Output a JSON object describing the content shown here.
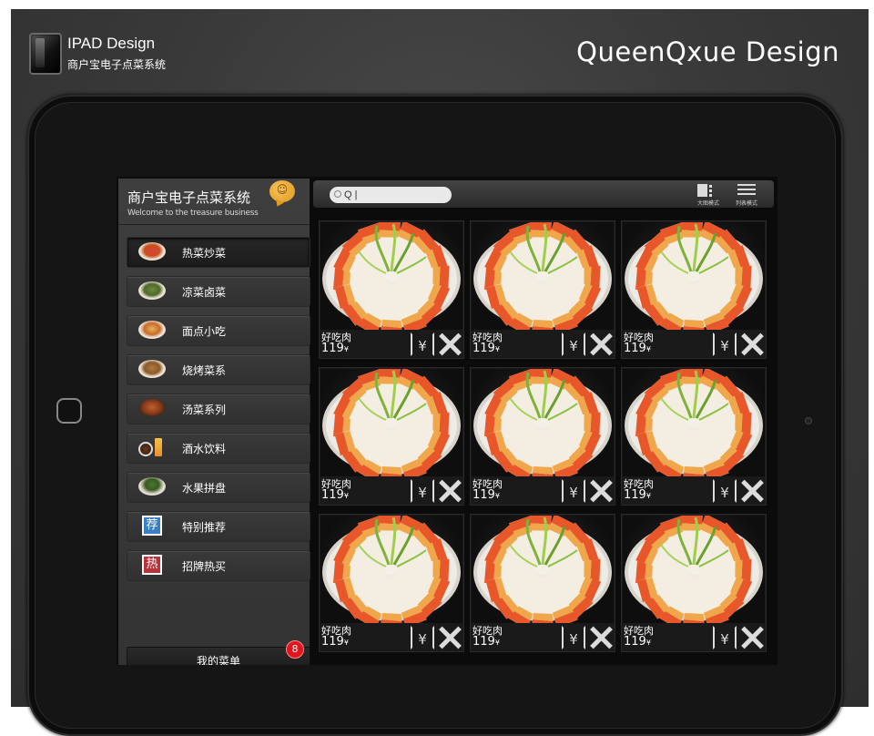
{
  "header": {
    "brand_title": "IPAD Design",
    "brand_subtitle": "商户宝电子点菜系统",
    "top_right": "QueenQxue Design"
  },
  "app": {
    "title": "商户宝电子点菜系统",
    "subtitle": "Welcome to the treasure business",
    "bubble": "☺"
  },
  "sidebar": {
    "items": [
      {
        "label": "热菜炒菜",
        "icon": "dish-icon",
        "active": true
      },
      {
        "label": "凉菜卤菜",
        "icon": "dish-icon"
      },
      {
        "label": "面点小吃",
        "icon": "dish-icon"
      },
      {
        "label": "烧烤菜系",
        "icon": "dish-icon"
      },
      {
        "label": "汤菜系列",
        "icon": "soup-icon"
      },
      {
        "label": "酒水饮料",
        "icon": "drink-icon"
      },
      {
        "label": "水果拼盘",
        "icon": "fruit-icon"
      },
      {
        "label": "特别推荐",
        "icon": "recommend-icon",
        "tag": "荐"
      },
      {
        "label": "招牌热买",
        "icon": "hot-icon",
        "tag": "热"
      }
    ],
    "cart": {
      "label": "我的菜单",
      "count": "8"
    }
  },
  "search": {
    "value": "Q |",
    "placeholder": ""
  },
  "view_modes": {
    "large": "大图模式",
    "list": "列表模式"
  },
  "dishes": [
    {
      "name": "好吃肉",
      "price": "119",
      "currency": "¥"
    },
    {
      "name": "好吃肉",
      "price": "119",
      "currency": "¥"
    },
    {
      "name": "好吃肉",
      "price": "119",
      "currency": "¥"
    },
    {
      "name": "好吃肉",
      "price": "119",
      "currency": "¥"
    },
    {
      "name": "好吃肉",
      "price": "119",
      "currency": "¥"
    },
    {
      "name": "好吃肉",
      "price": "119",
      "currency": "¥"
    },
    {
      "name": "好吃肉",
      "price": "119",
      "currency": "¥"
    },
    {
      "name": "好吃肉",
      "price": "119",
      "currency": "¥"
    },
    {
      "name": "好吃肉",
      "price": "119",
      "currency": "¥"
    }
  ],
  "order_button_symbol": "¥",
  "colors": {
    "background": "#3a3a3a",
    "device": "#151515",
    "cart_badge": "#e2141e",
    "bubble": "#e09a1c"
  }
}
